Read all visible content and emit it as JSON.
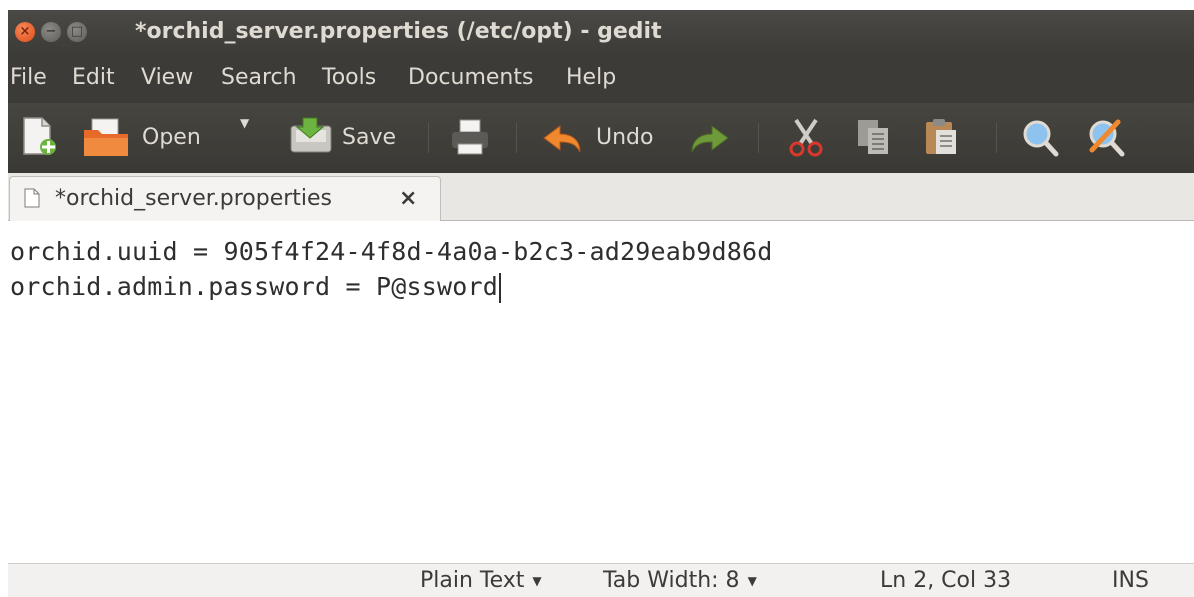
{
  "window": {
    "title": "*orchid_server.properties (/etc/opt) - gedit",
    "close_glyph": "×",
    "minimize_glyph": "−",
    "maximize_glyph": "□"
  },
  "menu": [
    "File",
    "Edit",
    "View",
    "Search",
    "Tools",
    "Documents",
    "Help"
  ],
  "toolbar": {
    "new_icon": "new-document-icon",
    "open_label": "Open",
    "open_dropdown": "▼",
    "save_label": "Save",
    "print_icon": "print-icon",
    "undo_label": "Undo",
    "redo_icon": "redo-icon",
    "cut_icon": "cut-icon",
    "copy_icon": "copy-icon",
    "paste_icon": "paste-icon",
    "find_icon": "search-icon",
    "replace_icon": "find-replace-icon"
  },
  "tab": {
    "label": "*orchid_server.properties",
    "close": "×"
  },
  "editor": {
    "lines": [
      "orchid.uuid = 905f4f24-4f8d-4a0a-b2c3-ad29eab9d86d",
      "orchid.admin.password = P@ssword"
    ]
  },
  "status": {
    "language": "Plain Text",
    "tab_width": "Tab Width: 8",
    "position": "Ln 2, Col 33",
    "mode": "INS",
    "dropdown": "▼"
  },
  "colors": {
    "titlebar": "#3c3b37",
    "text_light": "#dfdbd2",
    "close_button": "#df4a16",
    "editor_bg": "#ffffff"
  }
}
